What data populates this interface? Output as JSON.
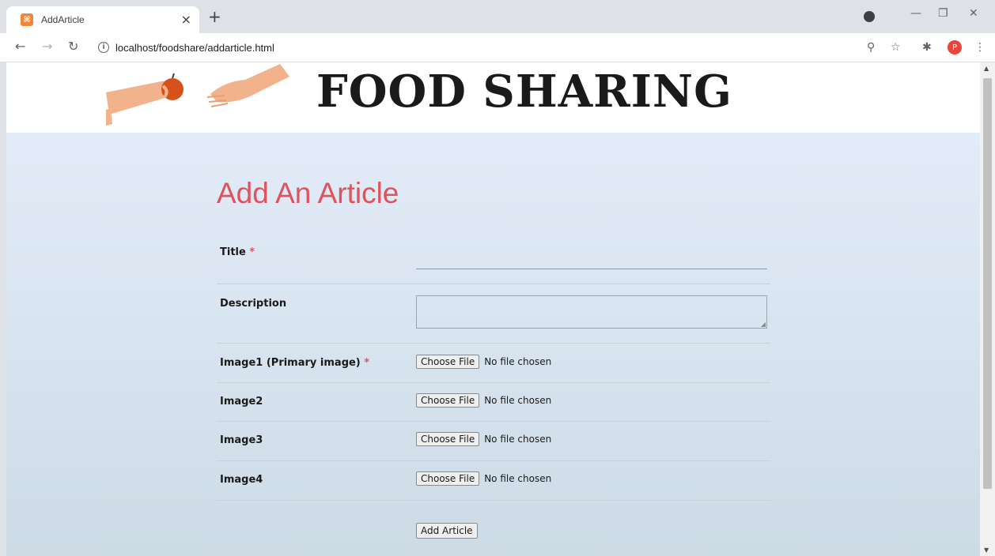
{
  "browser": {
    "tab_title": "AddArticle",
    "tab_close": "×",
    "new_tab": "+",
    "favicon_glyph": "⌘",
    "url": "localhost/foodshare/addarticle.html",
    "avatar_letter": "P",
    "icons": [
      "back-icon",
      "forward-icon",
      "reload-icon",
      "info-icon",
      "zoom-icon",
      "star-icon",
      "extensions-icon",
      "menu-icon"
    ]
  },
  "site": {
    "title": "FOOD SHARING"
  },
  "page": {
    "heading": "Add An Article"
  },
  "form": {
    "required_mark": "*",
    "fields": [
      {
        "label": "Title",
        "required": true,
        "type": "text",
        "value": ""
      },
      {
        "label": "Description",
        "required": false,
        "type": "textarea",
        "value": ""
      },
      {
        "label": "Image1 (Primary image)",
        "required": true,
        "type": "file"
      },
      {
        "label": "Image2",
        "required": false,
        "type": "file"
      },
      {
        "label": "Image3",
        "required": false,
        "type": "file"
      },
      {
        "label": "Image4",
        "required": false,
        "type": "file"
      }
    ],
    "choose_file_label": "Choose File",
    "no_file_text": "No file chosen",
    "submit_label": "Add Article"
  },
  "colors": {
    "accent": "#e0525c",
    "background_top": "#e2ecf8",
    "background_bottom": "#cddbe6"
  }
}
